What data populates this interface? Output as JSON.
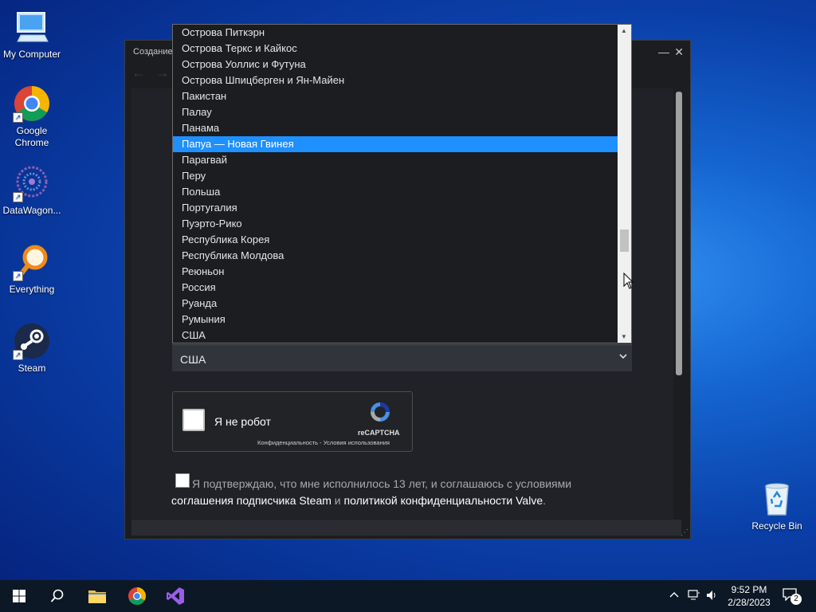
{
  "desktop": {
    "icons": [
      {
        "label": "My Computer"
      },
      {
        "label": "Google Chrome"
      },
      {
        "label": "DataWagon..."
      },
      {
        "label": "Everything"
      },
      {
        "label": "Steam"
      },
      {
        "label": "Recycle Bin"
      }
    ]
  },
  "window": {
    "title": "Создание",
    "minimize_glyph": "—",
    "close_glyph": "✕"
  },
  "dropdown": {
    "options": [
      "Острова Питкэрн",
      "Острова Теркс и Кайкос",
      "Острова Уоллис и Футуна",
      "Острова Шпицберген и Ян-Майен",
      "Пакистан",
      "Палау",
      "Панама",
      "Папуа — Новая Гвинея",
      "Парагвай",
      "Перу",
      "Польша",
      "Португалия",
      "Пуэрто-Рико",
      "Республика Корея",
      "Республика Молдова",
      "Реюньон",
      "Россия",
      "Руанда",
      "Румыния",
      "США"
    ],
    "highlighted": "Папуа — Новая Гвинея"
  },
  "country_select": {
    "value": "США"
  },
  "captcha": {
    "label": "Я не робот",
    "brand": "reCAPTCHA",
    "terms": "Конфиденциальность - Условия использования"
  },
  "agreement": {
    "text_before": "Я подтверждаю, что мне исполнилось 13 лет, и соглашаюсь с условиями ",
    "link1": "соглашения подписчика Steam",
    "middle": " и ",
    "link2": "политикой конфиденциальности Valve",
    "end": "."
  },
  "taskbar": {
    "time": "9:52 PM",
    "date": "2/28/2023",
    "notification_count": "2"
  },
  "colors": {
    "selection": "#1e90ff",
    "window_bg": "#1b1d21",
    "taskbar_bg": "#0d1826"
  }
}
